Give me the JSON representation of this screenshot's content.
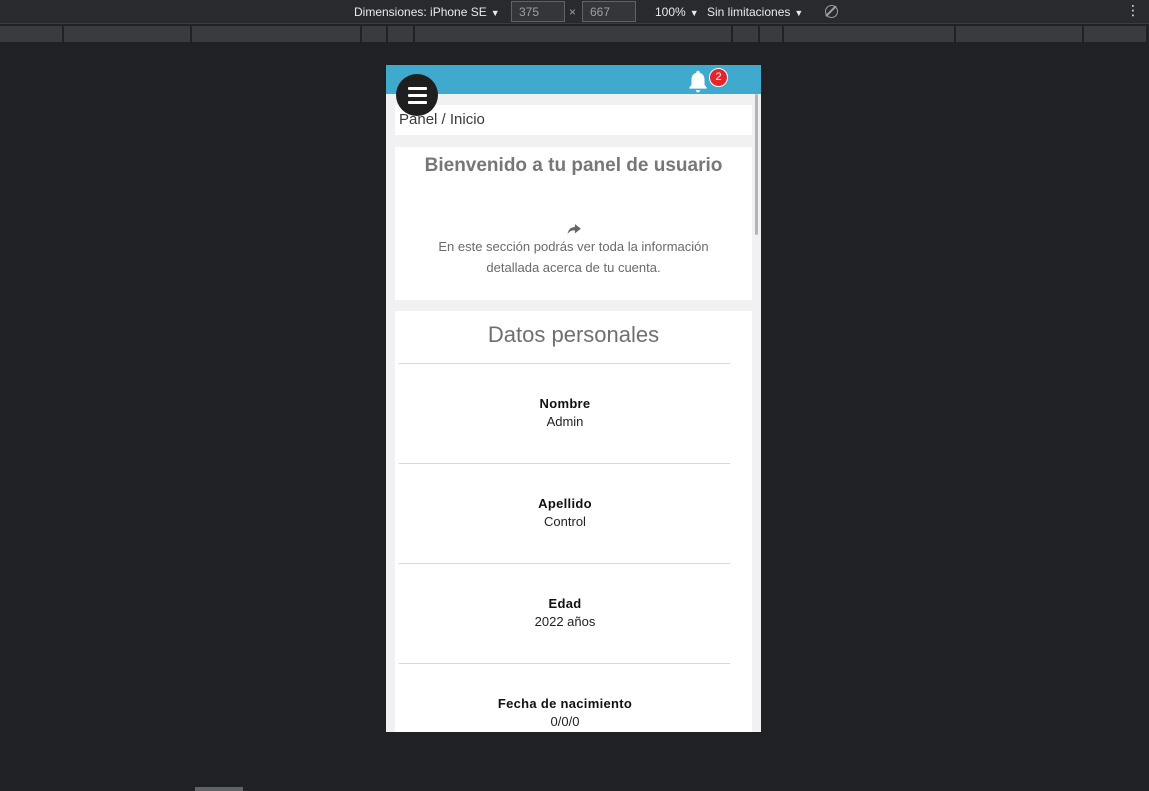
{
  "devtools": {
    "device_label": "Dimensiones: iPhone SE",
    "width": "375",
    "height": "667",
    "times": "×",
    "zoom": "100%",
    "throttling": "Sin limitaciones"
  },
  "app": {
    "notification_count": "2",
    "breadcrumb": "Panel / Inicio",
    "welcome": {
      "title": "Bienvenido a tu panel de usuario",
      "text": "En este sección podrás ver toda la información detallada acerca de tu cuenta."
    },
    "personal": {
      "title": "Datos personales",
      "fields": [
        {
          "label": "Nombre",
          "value": "Admin"
        },
        {
          "label": "Apellido",
          "value": "Control"
        },
        {
          "label": "Edad",
          "value": "2022 años"
        },
        {
          "label": "Fecha de nacimiento",
          "value": "0/0/0"
        }
      ]
    }
  },
  "colors": {
    "topbar": "#3fa9ce",
    "badge": "#e4262c",
    "menu_button": "#1f1f1f"
  },
  "icons": [
    "menu-icon",
    "bell-icon",
    "share-icon",
    "rotate-icon",
    "kebab-icon"
  ]
}
